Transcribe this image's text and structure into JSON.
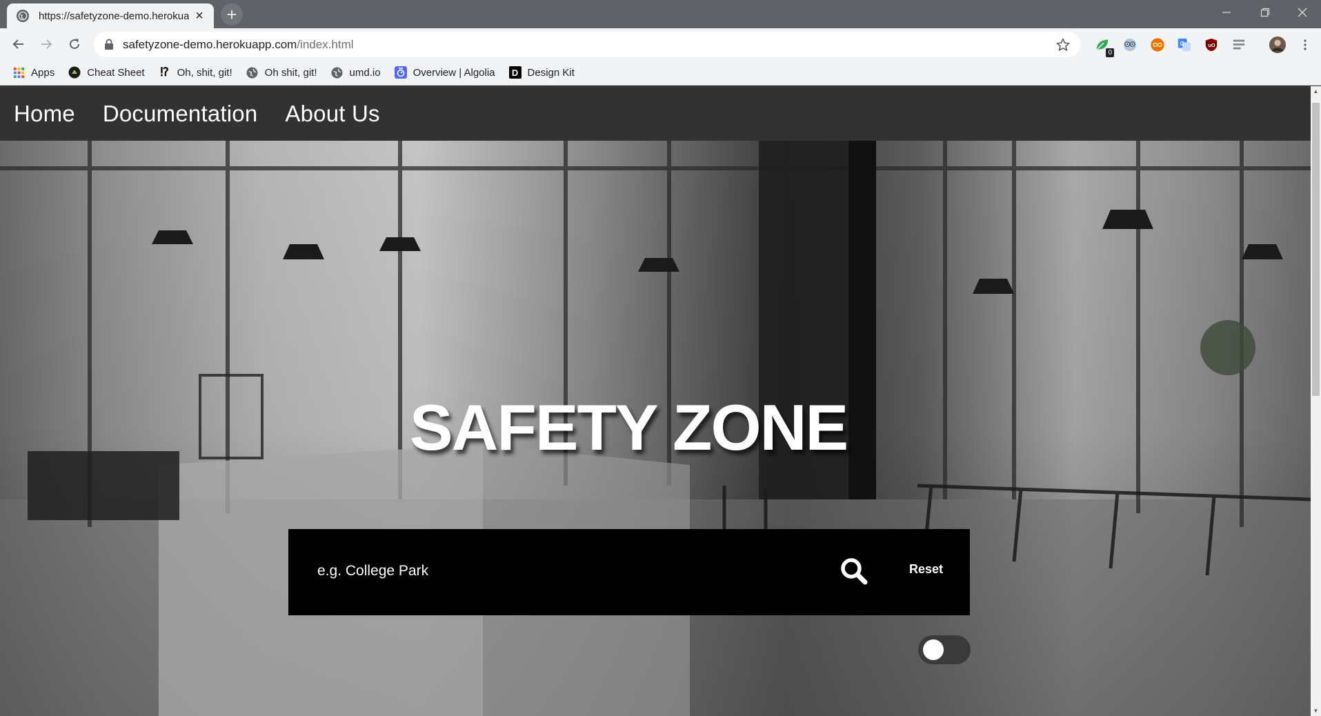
{
  "browser": {
    "tab_title": "https://safetyzone-demo.herokuapp.com/index.html",
    "url_host": "safetyzone-demo.herokuapp.com",
    "url_path": "/index.html",
    "new_tab_glyph": "+",
    "close_glyph": "×",
    "extensions": [
      {
        "name": "leaf-badge-extension",
        "badge": "0"
      },
      {
        "name": "owl-extension"
      },
      {
        "name": "infinity-extension"
      },
      {
        "name": "translate-extension"
      },
      {
        "name": "ublock-extension"
      },
      {
        "name": "reader-extension"
      }
    ]
  },
  "bookmarks": [
    {
      "label": "Apps",
      "icon": "apps-grid-icon"
    },
    {
      "label": "Cheat Sheet",
      "icon": "cheat-sheet-icon"
    },
    {
      "label": "Oh, shit, git!",
      "icon": "interrobang-icon",
      "icon_text": "⁉"
    },
    {
      "label": "Oh shit, git!",
      "icon": "globe-icon"
    },
    {
      "label": "umd.io",
      "icon": "globe-icon"
    },
    {
      "label": "Overview | Algolia",
      "icon": "algolia-icon"
    },
    {
      "label": "Design Kit",
      "icon": "design-kit-icon",
      "icon_text": "D"
    }
  ],
  "site_nav": {
    "home": "Home",
    "documentation": "Documentation",
    "about": "About Us"
  },
  "hero": {
    "title": "SAFETY ZONE"
  },
  "search": {
    "placeholder": "e.g. College Park",
    "reset_label": "Reset"
  },
  "toggle": {
    "state": "off"
  },
  "colors": {
    "nav_bg": "#323232",
    "search_bg": "#000000",
    "chrome_frame": "#5f6368",
    "chrome_toolbar": "#f1f3f4"
  }
}
